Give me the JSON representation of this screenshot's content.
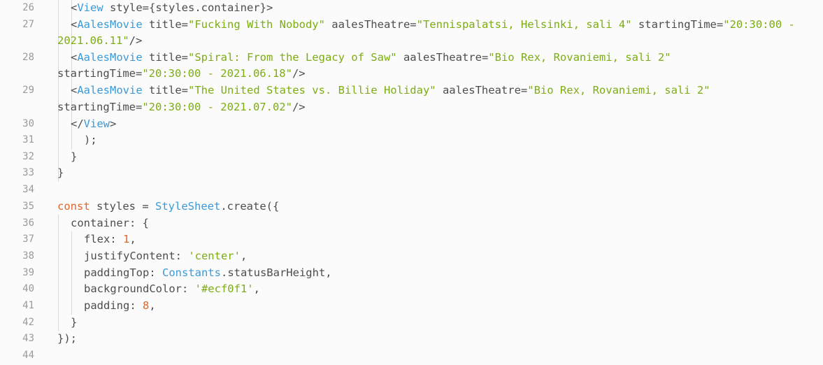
{
  "editor": {
    "colors": {
      "background": "#fbfbfb",
      "text": "#4d4d4c",
      "tag": "#3a9ad9",
      "string": "#7cad12",
      "keyword": "#e0672a",
      "line_number": "#9a9a9a"
    },
    "line_numbers": [
      "26",
      "27",
      "28",
      "29",
      "30",
      "31",
      "32",
      "33",
      "34",
      "35",
      "36",
      "37",
      "38",
      "39",
      "40",
      "41",
      "42",
      "43",
      "44"
    ],
    "code": {
      "l26": {
        "open": "<",
        "tag": "View",
        "rest": " style={styles.container}>"
      },
      "l27a": {
        "open": "<",
        "tag": "AalesMovie",
        "a1": " title=",
        "v1": "\"Fucking With Nobody\"",
        "a2": " aalesTheatre=",
        "v2": "\"Tennispalatsi, Helsinki, sali 4\"",
        "a3": " startingTime=",
        "v3": "\"20:30:00 -"
      },
      "l27b": {
        "v3": "2021.06.11\"",
        "close": "/>"
      },
      "l28a": {
        "open": "<",
        "tag": "AalesMovie",
        "a1": " title=",
        "v1": "\"Spiral: From the Legacy of Saw\"",
        "a2": " aalesTheatre=",
        "v2": "\"Bio Rex, Rovaniemi, sali 2\""
      },
      "l28b": {
        "a3": "startingTime=",
        "v3": "\"20:30:00 - 2021.06.18\"",
        "close": "/>"
      },
      "l29a": {
        "open": "<",
        "tag": "AalesMovie",
        "a1": " title=",
        "v1": "\"The United States vs. Billie Holiday\"",
        "a2": " aalesTheatre=",
        "v2": "\"Bio Rex, Rovaniemi, sali 2\""
      },
      "l29b": {
        "a3": "startingTime=",
        "v3": "\"20:30:00 - 2021.07.02\"",
        "close": "/>"
      },
      "l30": {
        "open": "</",
        "tag": "View",
        "close": ">"
      },
      "l31": ");",
      "l32": "}",
      "l33": "}",
      "l35": {
        "kw": "const",
        "mid": " styles = ",
        "cls": "StyleSheet",
        "rest": ".create({"
      },
      "l36": "container: {",
      "l37": {
        "key": "flex: ",
        "num": "1",
        "end": ","
      },
      "l38": {
        "key": "justifyContent: ",
        "str": "'center'",
        "end": ","
      },
      "l39": {
        "key": "paddingTop: ",
        "cls": "Constants",
        "rest": ".statusBarHeight,"
      },
      "l40": {
        "key": "backgroundColor: ",
        "str": "'#ecf0f1'",
        "end": ","
      },
      "l41": {
        "key": "padding: ",
        "num": "8",
        "end": ","
      },
      "l42": "}",
      "l43": "});"
    }
  }
}
